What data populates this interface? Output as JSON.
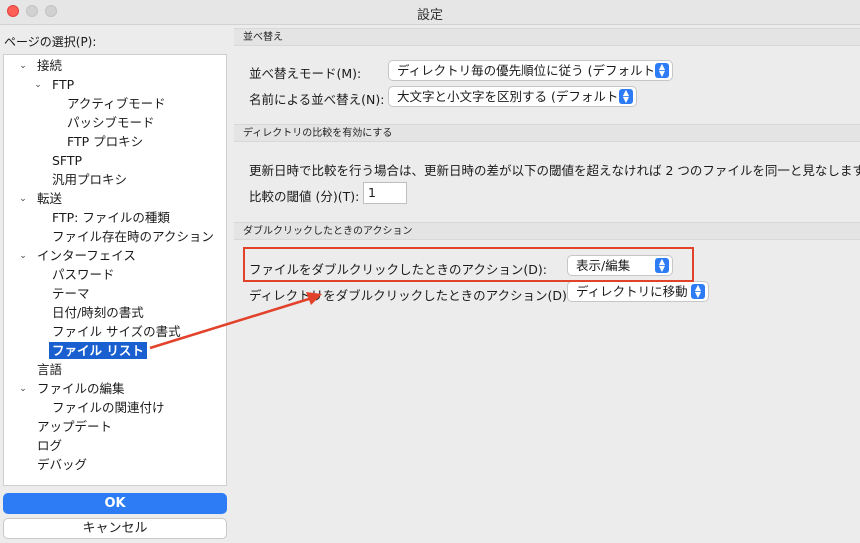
{
  "window": {
    "title": "設定"
  },
  "sidebar": {
    "label": "ページの選択(P):",
    "items": [
      {
        "label": "接続"
      },
      {
        "label": "FTP"
      },
      {
        "label": "アクティブモード"
      },
      {
        "label": "パッシブモード"
      },
      {
        "label": "FTP プロキシ"
      },
      {
        "label": "SFTP"
      },
      {
        "label": "汎用プロキシ"
      },
      {
        "label": "転送"
      },
      {
        "label": "FTP: ファイルの種類"
      },
      {
        "label": "ファイル存在時のアクション"
      },
      {
        "label": "インターフェイス"
      },
      {
        "label": "パスワード"
      },
      {
        "label": "テーマ"
      },
      {
        "label": "日付/時刻の書式"
      },
      {
        "label": "ファイル サイズの書式"
      },
      {
        "label": "ファイル リスト"
      },
      {
        "label": "言語"
      },
      {
        "label": "ファイルの編集"
      },
      {
        "label": "ファイルの関連付け"
      },
      {
        "label": "アップデート"
      },
      {
        "label": "ログ"
      },
      {
        "label": "デバッグ"
      }
    ]
  },
  "buttons": {
    "ok": "OK",
    "cancel": "キャンセル"
  },
  "sort": {
    "header": "並べ替え",
    "mode_label": "並べ替えモード(M):",
    "mode_value": "ディレクトリ毎の優先順位に従う (デフォルト)",
    "name_label": "名前による並べ替え(N):",
    "name_value": "大文字と小文字を区別する (デフォルト)"
  },
  "compare": {
    "header": "ディレクトリの比較を有効にする",
    "description": "更新日時で比較を行う場合は、更新日時の差が以下の閾値を超えなければ 2 つのファイルを同一と見なします。",
    "threshold_label": "比較の閾値 (分)(T):",
    "threshold_value": "1"
  },
  "doubleclick": {
    "header": "ダブルクリックしたときのアクション",
    "file_label": "ファイルをダブルクリックしたときのアクション(D):",
    "file_value": "表示/編集",
    "dir_label": "ディレクトリをダブルクリックしたときのアクション(D):",
    "dir_value": "ディレクトリに移動"
  },
  "colors": {
    "accent": "#2d7cf6",
    "selection": "#1a5fd0",
    "annotation": "#e2412a"
  }
}
